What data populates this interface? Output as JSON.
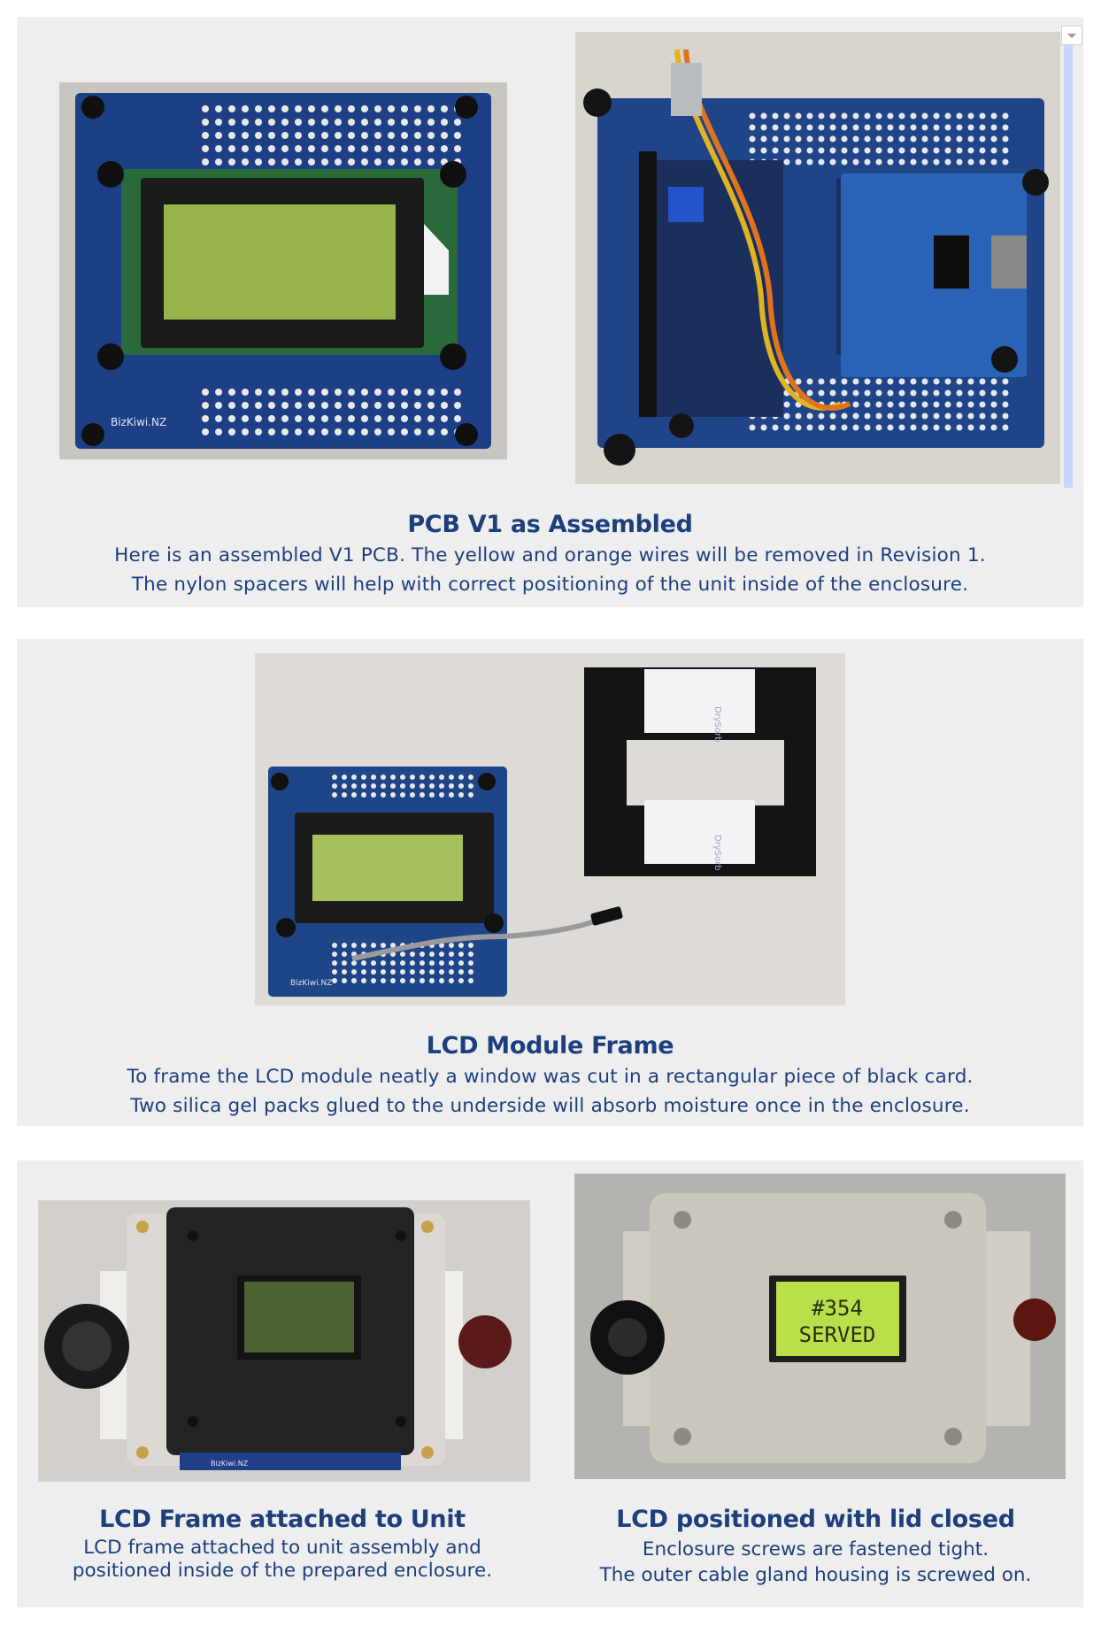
{
  "sections": [
    {
      "title": "PCB V1 as Assembled",
      "lines": [
        "Here is an assembled V1 PCB. The yellow and orange wires will be removed in Revision 1.",
        "The nylon spacers will help with correct positioning of the unit inside of the enclosure."
      ],
      "photos": [
        "pcb-front-lcd-photo",
        "pcb-rear-modules-photo"
      ]
    },
    {
      "title": "LCD Module Frame",
      "lines": [
        "To frame the LCD module neatly a window was cut in a rectangular piece of black card.",
        "Two silica gel packs glued to the underside will absorb moisture once in the enclosure."
      ],
      "photos": [
        "lcd-module-and-frame-photo"
      ]
    },
    {
      "left": {
        "title": "LCD Frame attached to Unit",
        "lines": [
          "LCD frame attached to unit assembly and",
          "positioned inside of the prepared enclosure."
        ]
      },
      "right": {
        "title": "LCD positioned with lid closed",
        "lines": [
          "Enclosure screws are fastened tight.",
          "The outer cable gland housing is screwed on."
        ]
      }
    }
  ],
  "photo_text": {
    "board_brand": "BizKiwi.NZ",
    "lcd_line1": "#354",
    "lcd_line2": "SERVED",
    "silica_label": "DrySorb"
  },
  "colors": {
    "caption": "#1d3f7c",
    "panel_bg": "#eeeeef",
    "pcb_blue": "#1c3f86",
    "lcd_green": "#9cc04a",
    "scrollbar": "#c5d6ff"
  },
  "icons": [
    "scroll-down-arrow-icon"
  ]
}
